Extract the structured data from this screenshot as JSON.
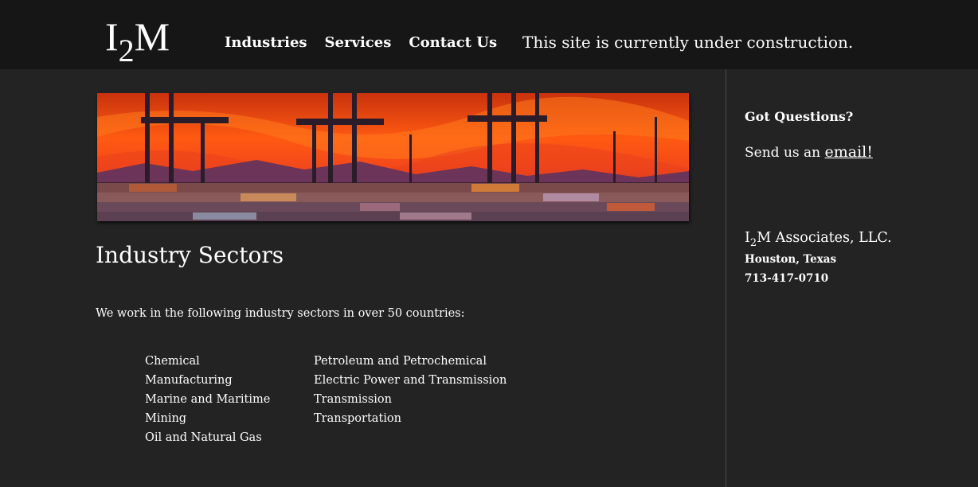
{
  "header": {
    "logo_prefix": "I",
    "logo_sub": "2",
    "logo_suffix": "M",
    "nav": [
      {
        "label": "Industries"
      },
      {
        "label": "Services"
      },
      {
        "label": "Contact Us"
      }
    ],
    "notice": "This site is currently under construction."
  },
  "main": {
    "banner_alt_icon": "port-cranes-sunset-image",
    "title": "Industry Sectors",
    "intro": "We work in the following industry sectors in over 50 countries:",
    "sectors_col1": [
      "Chemical",
      "Manufacturing",
      "Marine and Maritime",
      "Mining",
      "Oil and Natural Gas"
    ],
    "sectors_col2": [
      "Petroleum and Petrochemical",
      "Electric Power and Transmission",
      "Transmission",
      "Transportation"
    ]
  },
  "sidebar": {
    "question": "Got Questions?",
    "send_prefix": "Send us an ",
    "send_link": "email!",
    "company_prefix": "I",
    "company_sub": "2",
    "company_suffix": "M Associates, LLC.",
    "city": "Houston, Texas",
    "phone": "713-417-0710"
  },
  "colors": {
    "page_bg": "#232323",
    "header_bg": "#161616",
    "text": "#ffffff",
    "divider": "#4a4a4a"
  }
}
